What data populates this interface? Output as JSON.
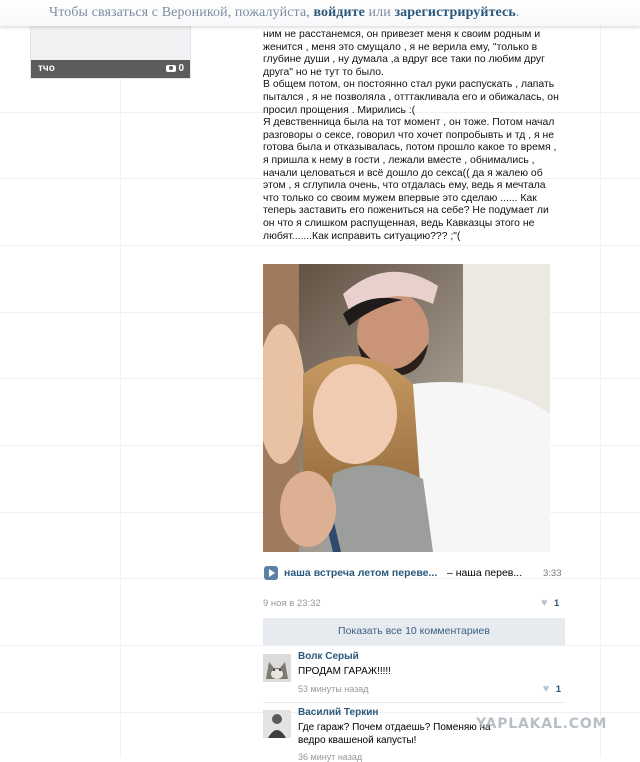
{
  "banner": {
    "prefix": "Чтобы связаться с Вероникой, пожалуйста, ",
    "login_link": "войдите",
    "middle": " или ",
    "register_link": "зарегистрируйтесь",
    "suffix": "."
  },
  "album": {
    "name": "тчо",
    "count": "0"
  },
  "post": {
    "paragraphs": [
      "ним не расстанемся, он привезет меня к своим родным и женится , меня это смущало , я не верила ему, \"только в глубине души , ну думала ,а вдруг все таки по любим друг друга\" но не тут то было.",
      "В общем потом, он постоянно стал руки распускать , лапать пытался , я не позволяла , отттакливала его и обижалась, он просил прощения . Мирились :(",
      "Я девственница была на тот момент , он тоже. Потом начал разговоры о сексе, говорил что хочет попробывть и тд , я не готова была и отказывалась, потом прошло какое то время , я пришла к нему в гости , лежали вместе , обнимались , начали целоваться и всё дошло до секса(( да я жалею об этом , я сглупила очень, что отдалась ему, ведь я мечтала что только со своим мужем впервые это сделаю ...... Как теперь заставить его пожениться на себе? Не подумает ли он что я слишком распущенная, ведь Кавказцы этого не любят.......Как исправить ситуацию??? ;\"("
    ]
  },
  "audio": {
    "title": "наша встреча летом переве...",
    "artist": "– наша перев...",
    "duration": "3:33"
  },
  "meta": {
    "date": "9 ноя в 23:32",
    "likes": "1"
  },
  "show_all": "Показать все 10 комментариев",
  "comments": [
    {
      "author": "Волк Серый",
      "text": "ПРОДАМ ГАРАЖ!!!!!",
      "time": "53 минуты назад",
      "likes": "1"
    },
    {
      "author": "Василий Теркин",
      "text": "Где гараж? Почем отдаешь? Поменяю на ведро квашеной капусты!",
      "time": "36 минут назад",
      "likes": ""
    }
  ],
  "watermark": "YAPLAKAL.COM",
  "colors": {
    "link": "#2b587a",
    "banner_text": "#7c8da3",
    "button_bg": "#e7ebf0",
    "muted": "#999999"
  }
}
